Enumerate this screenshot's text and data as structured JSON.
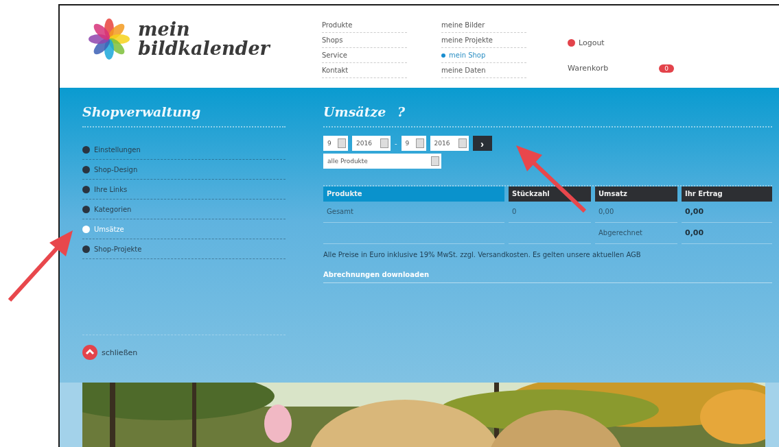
{
  "header": {
    "logo": {
      "line1": "mein",
      "line2": "bildkalender"
    },
    "nav_columns": [
      [
        {
          "label": "Produkte",
          "selected": false
        },
        {
          "label": "Shops",
          "selected": false
        },
        {
          "label": "Service",
          "selected": false
        },
        {
          "label": "Kontakt",
          "selected": false
        }
      ],
      [
        {
          "label": "meine Bilder",
          "selected": false
        },
        {
          "label": "meine Projekte",
          "selected": false
        },
        {
          "label": "mein Shop",
          "selected": true
        },
        {
          "label": "meine Daten",
          "selected": false
        }
      ]
    ],
    "logout": "Logout",
    "cart": {
      "label": "Warenkorb",
      "count": "0"
    }
  },
  "sidebar": {
    "title": "Shopverwaltung",
    "items": [
      {
        "label": "Einstellungen",
        "selected": false
      },
      {
        "label": "Shop-Design",
        "selected": false
      },
      {
        "label": "Ihre Links",
        "selected": false
      },
      {
        "label": "Kategorien",
        "selected": false
      },
      {
        "label": "Umsätze",
        "selected": true
      },
      {
        "label": "Shop-Projekte",
        "selected": false
      }
    ],
    "close": "schließen"
  },
  "main": {
    "title": "Umsätze",
    "help": "?",
    "date_selects": [
      {
        "value": "9"
      },
      {
        "value": "2016"
      },
      {
        "value": "9"
      },
      {
        "value": "2016"
      }
    ],
    "separator": "-",
    "go": "›",
    "product_select": "alle Produkte",
    "table": {
      "columns": [
        {
          "label": "Produkte",
          "selected": true
        },
        {
          "label": "Stückzahl",
          "selected": false
        },
        {
          "label": "Umsatz",
          "selected": false
        },
        {
          "label": "Ihr Ertrag",
          "selected": false
        }
      ],
      "rows": [
        [
          "Gesamt",
          "0",
          "0,00",
          "0,00"
        ]
      ],
      "settled": {
        "label": "Abgerechnet",
        "value": "0,00"
      }
    },
    "note": "Alle Preise in Euro inklusive 19% MwSt. zzgl. Versandkosten. Es gelten unsere aktuellen AGB",
    "download": "Abrechnungen downloaden"
  }
}
